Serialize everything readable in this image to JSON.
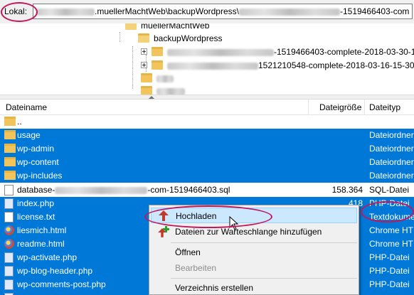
{
  "local_path": {
    "label": "Lokal:",
    "path_part1": ".muellerMachtWeb\\backupWordpress\\",
    "path_part2": "-1519466403-com"
  },
  "tree": {
    "items": [
      {
        "label": "muellerMachtWeb"
      },
      {
        "label": "backupWordpress"
      },
      {
        "label_suffix": "-1519466403-complete-2018-03-30-1"
      },
      {
        "label_suffix": "1521210548-complete-2018-03-16-15-30-0"
      },
      {
        "label_suffix": ""
      },
      {
        "label_suffix": ""
      }
    ]
  },
  "columns": {
    "name": "Dateiname",
    "size": "Dateigröße",
    "type": "Dateityp"
  },
  "files": [
    {
      "name": "..",
      "size": "",
      "type": "",
      "icon": "folder-icon",
      "selected": false
    },
    {
      "name": "usage",
      "size": "",
      "type": "Dateiordner",
      "icon": "folder-icon",
      "selected": true
    },
    {
      "name": "wp-admin",
      "size": "",
      "type": "Dateiordner",
      "icon": "folder-icon",
      "selected": true
    },
    {
      "name": "wp-content",
      "size": "",
      "type": "Dateiordner",
      "icon": "folder-icon",
      "selected": true
    },
    {
      "name": "wp-includes",
      "size": "",
      "type": "Dateiordner",
      "icon": "folder-icon",
      "selected": true
    },
    {
      "name_prefix": "database-",
      "name_suffix": "-com-1519466403.sql",
      "size": "158.364",
      "type": "SQL-Datei",
      "icon": "file-icon",
      "selected": false
    },
    {
      "name": "index.php",
      "size": "418",
      "type": "PHP-Datei",
      "icon": "php-file-icon",
      "selected": true
    },
    {
      "name": "license.txt",
      "size": "",
      "type": "Textdokume",
      "icon": "text-file-icon",
      "selected": true
    },
    {
      "name": "liesmich.html",
      "size": "",
      "type": "Chrome HT",
      "icon": "chrome-html-icon",
      "selected": true
    },
    {
      "name": "readme.html",
      "size": "",
      "type": "Chrome HT",
      "icon": "chrome-html-icon",
      "selected": true
    },
    {
      "name": "wp-activate.php",
      "size": "",
      "type": "PHP-Datei",
      "icon": "php-file-icon",
      "selected": true
    },
    {
      "name": "wp-blog-header.php",
      "size": "",
      "type": "PHP-Datei",
      "icon": "php-file-icon",
      "selected": true
    },
    {
      "name": "wp-comments-post.php",
      "size": "",
      "type": "PHP-Datei",
      "icon": "php-file-icon",
      "selected": true
    },
    {
      "name": "",
      "size": "",
      "type": "",
      "icon": "php-file-icon",
      "selected": true
    }
  ],
  "context_menu": {
    "upload": "Hochladen",
    "add_to_queue": "Dateien zur Warteschlange hinzufügen",
    "open": "Öffnen",
    "edit": "Bearbeiten",
    "create_dir": "Verzeichnis erstellen"
  },
  "colors": {
    "selection": "#0078d7",
    "annotation": "#c2185b",
    "menu_highlight": "#cce8ff"
  }
}
